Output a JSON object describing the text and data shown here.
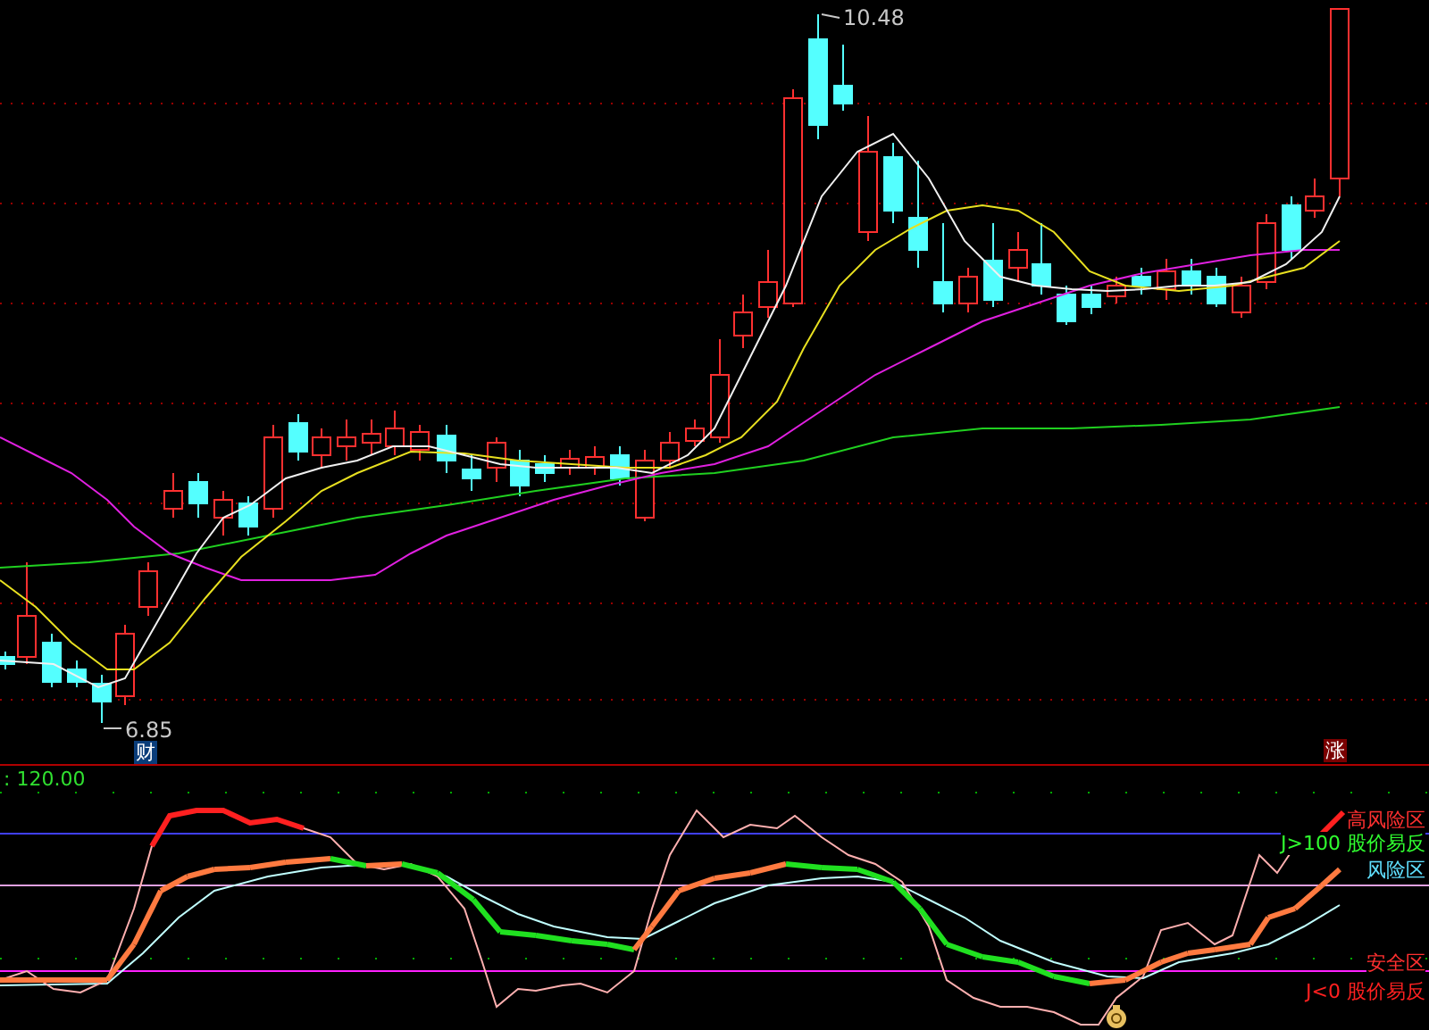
{
  "main_chart": {
    "high_label": "10.48",
    "low_label": "6.85",
    "markers": [
      {
        "text": "财",
        "kind": "finance"
      },
      {
        "text": "涨",
        "kind": "rise"
      }
    ]
  },
  "indicator": {
    "value": ": 120.00",
    "legend": [
      {
        "text": "高风险区",
        "color": "#ff3030"
      },
      {
        "text": "J>100 股价易反",
        "color": "#30ff30"
      },
      {
        "text": "风险区",
        "color": "#60e0ff"
      },
      {
        "text": "安全区",
        "color": "#ff3030"
      },
      {
        "text": "J<0 股价易反",
        "color": "#ff2020"
      }
    ]
  }
}
